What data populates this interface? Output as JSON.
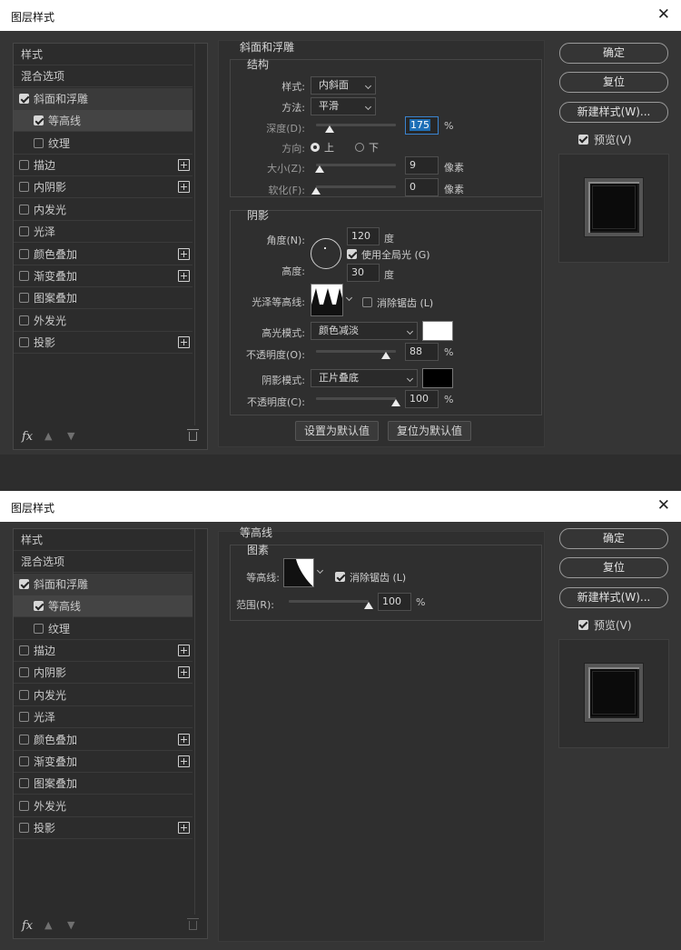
{
  "colors": {
    "title_bar": "#ffffff",
    "dialog_bg": "#353535",
    "accent": "#1e6fb6",
    "highlight_swatch": "#ffffff",
    "shadow_swatch": "#000000"
  },
  "dialog1": {
    "title": "图层样式",
    "left": {
      "items": [
        {
          "label": "样式"
        },
        {
          "label": "混合选项"
        },
        {
          "label": "斜面和浮雕",
          "checked": true
        },
        {
          "label": "等高线",
          "checked": true
        },
        {
          "label": "纹理",
          "checked": false
        },
        {
          "label": "描边",
          "checked": false
        },
        {
          "label": "内阴影",
          "checked": false
        },
        {
          "label": "内发光",
          "checked": false
        },
        {
          "label": "光泽",
          "checked": false
        },
        {
          "label": "颜色叠加",
          "checked": false
        },
        {
          "label": "渐变叠加",
          "checked": false
        },
        {
          "label": "图案叠加",
          "checked": false
        },
        {
          "label": "外发光",
          "checked": false
        },
        {
          "label": "投影",
          "checked": false
        }
      ],
      "fx": "fx"
    },
    "section_title": "斜面和浮雕",
    "structure": {
      "title": "结构",
      "style_label": "样式:",
      "style_value": "内斜面",
      "technique_label": "方法:",
      "technique_value": "平滑",
      "depth_label": "深度(D):",
      "depth_value": "175",
      "depth_unit": "%",
      "depth_fraction": 0.17,
      "direction_label": "方向:",
      "dir_up": "上",
      "dir_down": "下",
      "direction_selected": "上",
      "size_label": "大小(Z):",
      "size_value": "9",
      "size_unit": "像素",
      "size_fraction": 0.04,
      "soften_label": "软化(F):",
      "soften_value": "0",
      "soften_unit": "像素",
      "soften_fraction": 0
    },
    "shading": {
      "title": "阴影",
      "angle_label": "角度(N):",
      "angle_value": "120",
      "angle_unit": "度",
      "global_light": "使用全局光 (G)",
      "global_light_checked": true,
      "altitude_label": "高度:",
      "altitude_value": "30",
      "altitude_unit": "度",
      "gloss_label": "光泽等高线:",
      "antialias": "消除锯齿 (L)",
      "antialias_checked": false,
      "highlight_mode_label": "高光模式:",
      "highlight_mode": "颜色减淡",
      "hl_opacity_label": "不透明度(O):",
      "hl_opacity_value": "88",
      "hl_opacity_unit": "%",
      "hl_opacity_fraction": 0.88,
      "shadow_mode_label": "阴影模式:",
      "shadow_mode": "正片叠底",
      "sh_opacity_label": "不透明度(C):",
      "sh_opacity_value": "100",
      "sh_opacity_unit": "%",
      "sh_opacity_fraction": 1.0
    },
    "buttons": {
      "make_default": "设置为默认值",
      "reset_default": "复位为默认值"
    },
    "right": {
      "ok": "确定",
      "reset": "复位",
      "new_style": "新建样式(W)...",
      "preview": "预览(V)",
      "preview_checked": true
    }
  },
  "dialog2": {
    "title": "图层样式",
    "left": {
      "items": [
        {
          "label": "样式"
        },
        {
          "label": "混合选项"
        },
        {
          "label": "斜面和浮雕",
          "checked": true
        },
        {
          "label": "等高线",
          "checked": true
        },
        {
          "label": "纹理",
          "checked": false
        },
        {
          "label": "描边",
          "checked": false
        },
        {
          "label": "内阴影",
          "checked": false
        },
        {
          "label": "内发光",
          "checked": false
        },
        {
          "label": "光泽",
          "checked": false
        },
        {
          "label": "颜色叠加",
          "checked": false
        },
        {
          "label": "渐变叠加",
          "checked": false
        },
        {
          "label": "图案叠加",
          "checked": false
        },
        {
          "label": "外发光",
          "checked": false
        },
        {
          "label": "投影",
          "checked": false
        }
      ],
      "fx": "fx"
    },
    "section_title": "等高线",
    "elements": {
      "title": "图素",
      "contour_label": "等高线:",
      "antialias": "消除锯齿 (L)",
      "antialias_checked": true,
      "range_label": "范围(R):",
      "range_value": "100",
      "range_unit": "%",
      "range_fraction": 1.0
    },
    "right": {
      "ok": "确定",
      "reset": "复位",
      "new_style": "新建样式(W)...",
      "preview": "预览(V)",
      "preview_checked": true
    }
  }
}
